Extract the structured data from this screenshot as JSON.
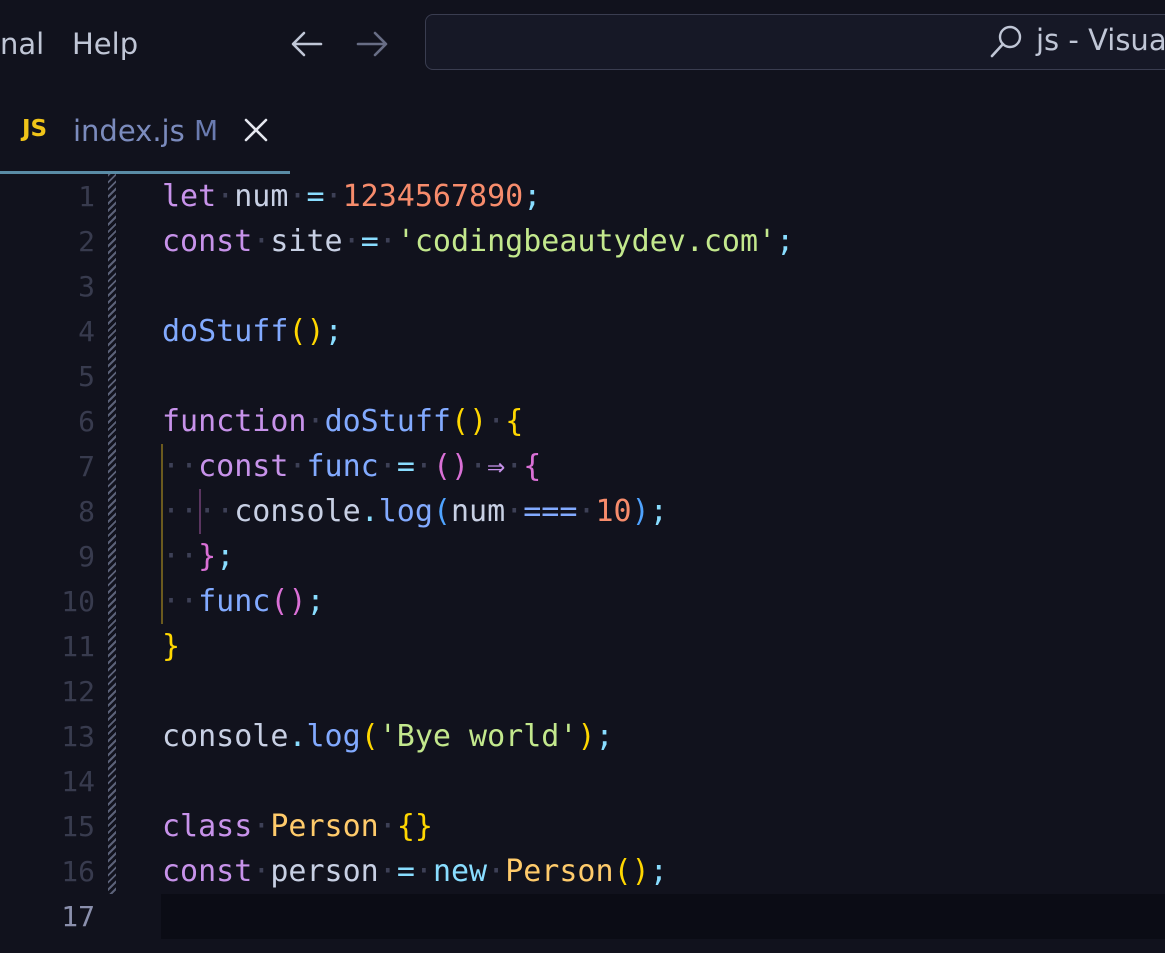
{
  "menu": {
    "terminal_partial": "nal",
    "help": "Help"
  },
  "command_center": {
    "text": "js - Visual"
  },
  "tab": {
    "icon_text": "JS",
    "filename": "index.js",
    "status": "M"
  },
  "line_numbers": [
    "1",
    "2",
    "3",
    "4",
    "5",
    "6",
    "7",
    "8",
    "9",
    "10",
    "11",
    "12",
    "13",
    "14",
    "15",
    "16",
    "17"
  ],
  "code": {
    "l1": {
      "kw": "let",
      "name": "num",
      "eq": "=",
      "value": "1234567890",
      "semi": ";"
    },
    "l2": {
      "kw": "const",
      "name": "site",
      "eq": "=",
      "value": "'codingbeautydev.com'",
      "semi": ";"
    },
    "l4": {
      "call": "doStuff",
      "open": "(",
      "close": ")",
      "semi": ";"
    },
    "l6": {
      "kw": "function",
      "name": "doStuff",
      "open": "(",
      "close": ")",
      "brace": "{"
    },
    "l7": {
      "kw": "const",
      "name": "func",
      "eq": "=",
      "open": "(",
      "close": ")",
      "arrow": "⇒",
      "brace": "{"
    },
    "l8": {
      "obj": "console",
      "dot": ".",
      "method": "log",
      "open": "(",
      "arg": "num",
      "cmp": "===",
      "value": "10",
      "close": ")",
      "semi": ";"
    },
    "l9": {
      "brace": "}",
      "semi": ";"
    },
    "l10": {
      "call": "func",
      "open": "(",
      "close": ")",
      "semi": ";"
    },
    "l11": {
      "brace": "}"
    },
    "l13": {
      "obj": "console",
      "dot": ".",
      "method": "log",
      "open": "(",
      "value": "'Bye world'",
      "close": ")",
      "semi": ";"
    },
    "l15": {
      "kw": "class",
      "name": "Person",
      "braces": "{}"
    },
    "l16": {
      "kw": "const",
      "name": "person",
      "eq": "=",
      "new_kw": "new",
      "cls": "Person",
      "open": "(",
      "close": ")",
      "semi": ";"
    }
  },
  "colors": {
    "background": "#11121d",
    "keyword": "#c792ea",
    "number": "#f78c6c",
    "string": "#c3e88d",
    "function": "#82aaff",
    "operator": "#89ddff",
    "bracket_level_1": "#ffd700",
    "bracket_level_2": "#da70d6",
    "bracket_level_3": "#4fa3ff",
    "class_name": "#ffcb6b"
  }
}
